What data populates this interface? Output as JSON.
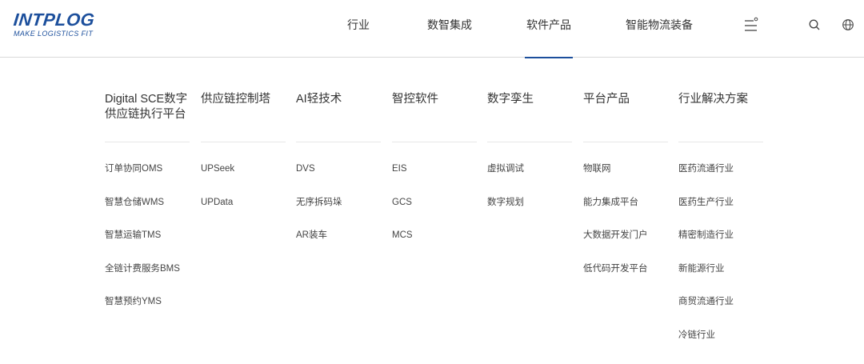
{
  "brand": {
    "logo_main": "INTPLOG",
    "logo_sub": "MAKE LOGISTICS FIT",
    "color": "#1c4f9c"
  },
  "nav": {
    "items": [
      {
        "label": "行业"
      },
      {
        "label": "数智集成"
      },
      {
        "label": "软件产品",
        "active": true
      },
      {
        "label": "智能物流装备"
      }
    ],
    "icons": [
      "menu-icon",
      "search-icon",
      "globe-icon"
    ]
  },
  "menu": {
    "columns": [
      {
        "title": "Digital SCE数字供应链执行平台",
        "items": [
          "订单协同OMS",
          "智慧仓储WMS",
          "智慧运输TMS",
          "全链计费服务BMS",
          "智慧预约YMS"
        ]
      },
      {
        "title": "供应链控制塔",
        "items": [
          "UPSeek",
          "UPData"
        ]
      },
      {
        "title": "AI轻技术",
        "items": [
          "DVS",
          "无序拆码垛",
          "AR装车"
        ]
      },
      {
        "title": "智控软件",
        "items": [
          "EIS",
          "GCS",
          "MCS"
        ]
      },
      {
        "title": "数字孪生",
        "items": [
          "虚拟调试",
          "数字规划"
        ]
      },
      {
        "title": "平台产品",
        "items": [
          "物联网",
          "能力集成平台",
          "大数据开发门户",
          "低代码开发平台"
        ]
      },
      {
        "title": "行业解决方案",
        "items": [
          "医药流通行业",
          "医药生产行业",
          "精密制造行业",
          "新能源行业",
          "商贸流通行业",
          "冷链行业"
        ]
      }
    ]
  }
}
